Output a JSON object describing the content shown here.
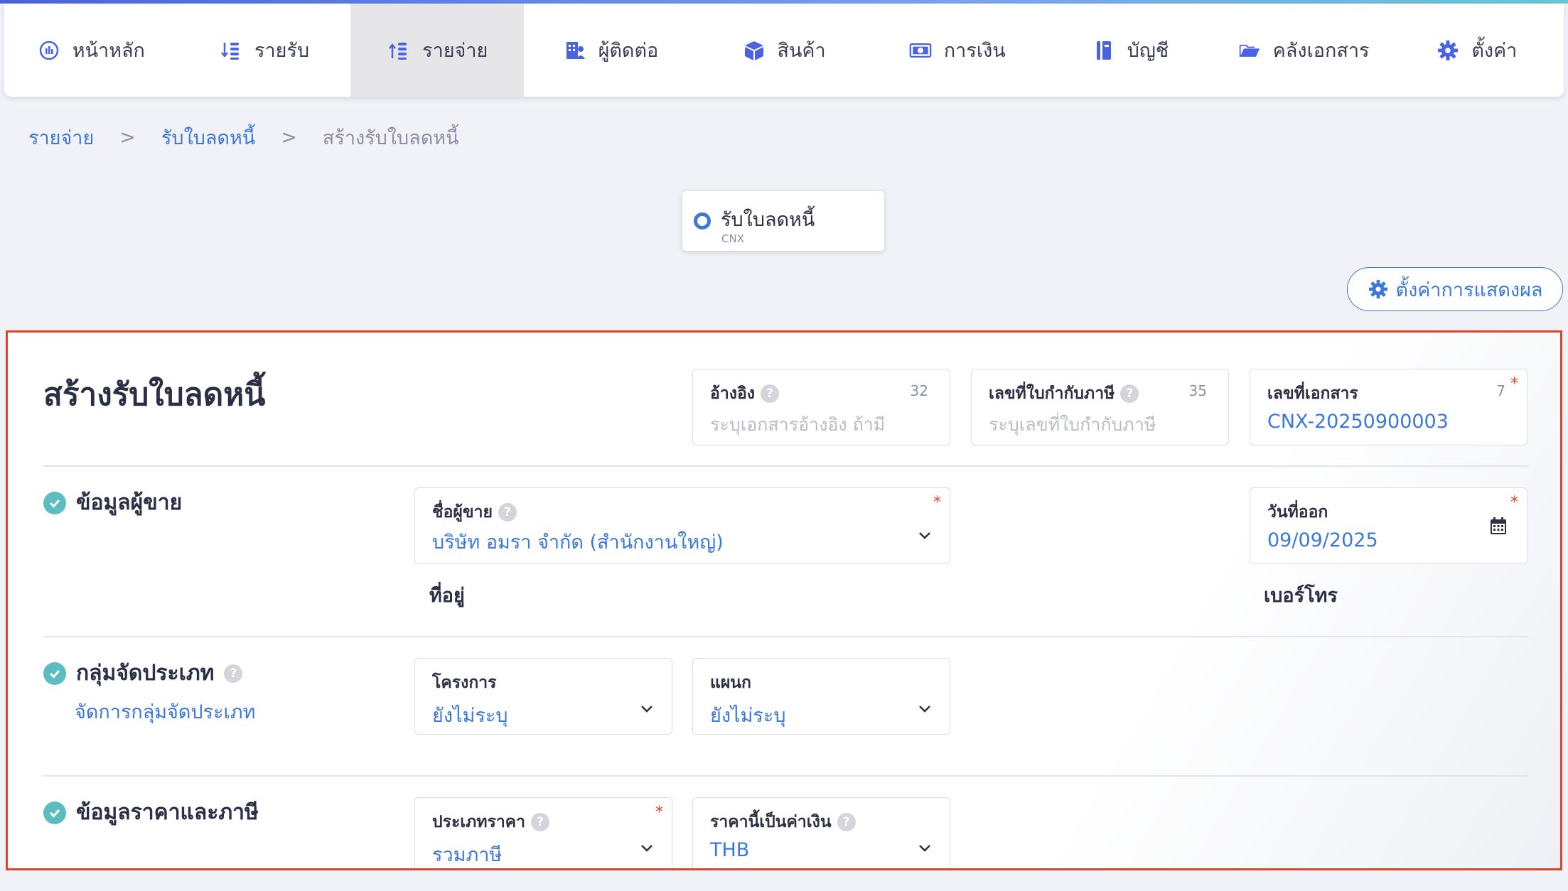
{
  "nav": {
    "items": [
      {
        "label": "หน้าหลัก",
        "icon": "dashboard-icon"
      },
      {
        "label": "รายรับ",
        "icon": "income-icon"
      },
      {
        "label": "รายจ่าย",
        "icon": "expense-icon"
      },
      {
        "label": "ผู้ติดต่อ",
        "icon": "contacts-icon"
      },
      {
        "label": "สินค้า",
        "icon": "product-box-icon"
      },
      {
        "label": "การเงิน",
        "icon": "money-icon"
      },
      {
        "label": "บัญชี",
        "icon": "ledger-book-icon"
      },
      {
        "label": "คลังเอกสาร",
        "icon": "folder-icon"
      },
      {
        "label": "ตั้งค่า",
        "icon": "gear-icon"
      }
    ],
    "active_index": 2
  },
  "breadcrumb": {
    "items": [
      "รายจ่าย",
      "รับใบลดหนี้",
      "สร้างรับใบลดหนี้"
    ],
    "separator": ">"
  },
  "doc_tab": {
    "title": "รับใบลดหนี้",
    "code": "CNX"
  },
  "display_settings_label": "ตั้งค่าการแสดงผล",
  "form": {
    "title": "สร้างรับใบลดหนี้",
    "reference": {
      "label": "อ้างอิง",
      "count": "32",
      "placeholder": "ระบุเอกสารอ้างอิง ถ้ามี"
    },
    "tax_invoice_no": {
      "label": "เลขที่ใบกำกับภาษี",
      "count": "35",
      "placeholder": "ระบุเลขที่ใบกำกับภาษี"
    },
    "doc_no": {
      "label": "เลขที่เอกสาร",
      "count": "7",
      "value": "CNX-20250900003",
      "required": "*"
    },
    "vendor_section": {
      "title": "ข้อมูลผู้ขาย",
      "vendor_name": {
        "label": "ชื่อผู้ขาย",
        "value": "บริษัท อมรา จำกัด (สำนักงานใหญ่)",
        "required": "*"
      },
      "issue_date": {
        "label": "วันที่ออก",
        "value": "09/09/2025",
        "required": "*"
      },
      "address_label": "ที่อยู่",
      "phone_label": "เบอร์โทร"
    },
    "classification_section": {
      "title": "กลุ่มจัดประเภท",
      "manage_link": "จัดการกลุ่มจัดประเภท",
      "project": {
        "label": "โครงการ",
        "value": "ยังไม่ระบุ"
      },
      "department": {
        "label": "แผนก",
        "value": "ยังไม่ระบุ"
      }
    },
    "pricing_section": {
      "title": "ข้อมูลราคาและภาษี",
      "price_type": {
        "label": "ประเภทราคา",
        "value": "รวมภาษี",
        "required": "*"
      },
      "currency": {
        "label": "ราคานี้เป็นค่าเงิน",
        "value": "THB"
      }
    }
  },
  "colors": {
    "accent": "#3b78d8",
    "highlight_border": "#e0432e",
    "check": "#5cbcc0"
  }
}
